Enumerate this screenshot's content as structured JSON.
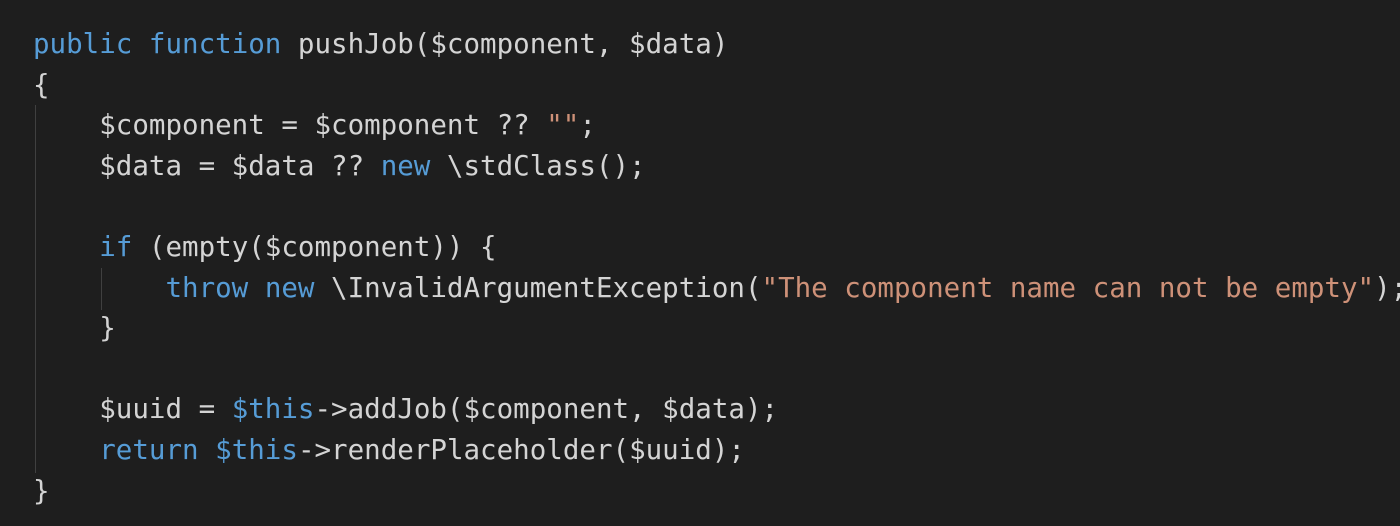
{
  "code": {
    "lines": [
      [
        {
          "t": "public",
          "c": "kw"
        },
        {
          "t": " ",
          "c": "plain"
        },
        {
          "t": "function",
          "c": "kw"
        },
        {
          "t": " pushJob($component, $data)",
          "c": "plain"
        }
      ],
      [
        {
          "t": "{",
          "c": "plain"
        }
      ],
      [
        {
          "t": "    $component = $component ?? ",
          "c": "plain"
        },
        {
          "t": "\"\"",
          "c": "str"
        },
        {
          "t": ";",
          "c": "plain"
        }
      ],
      [
        {
          "t": "    $data = $data ?? ",
          "c": "plain"
        },
        {
          "t": "new",
          "c": "kw"
        },
        {
          "t": " \\stdClass();",
          "c": "plain"
        }
      ],
      [],
      [
        {
          "t": "    ",
          "c": "plain"
        },
        {
          "t": "if",
          "c": "kw"
        },
        {
          "t": " (empty($component)) {",
          "c": "plain"
        }
      ],
      [
        {
          "t": "        ",
          "c": "plain"
        },
        {
          "t": "throw",
          "c": "kw"
        },
        {
          "t": " ",
          "c": "plain"
        },
        {
          "t": "new",
          "c": "kw"
        },
        {
          "t": " \\InvalidArgumentException(",
          "c": "plain"
        },
        {
          "t": "\"The component name can not be empty\"",
          "c": "str"
        },
        {
          "t": ");",
          "c": "plain"
        }
      ],
      [
        {
          "t": "    }",
          "c": "plain"
        }
      ],
      [],
      [
        {
          "t": "    $uuid = ",
          "c": "plain"
        },
        {
          "t": "$this",
          "c": "kw"
        },
        {
          "t": "->addJob($component, $data);",
          "c": "plain"
        }
      ],
      [
        {
          "t": "    ",
          "c": "plain"
        },
        {
          "t": "return",
          "c": "kw"
        },
        {
          "t": " ",
          "c": "plain"
        },
        {
          "t": "$this",
          "c": "kw"
        },
        {
          "t": "->renderPlaceholder($uuid);",
          "c": "plain"
        }
      ],
      [
        {
          "t": "}",
          "c": "plain"
        }
      ]
    ]
  },
  "colors": {
    "background": "#1e1e1e",
    "text": "#d4d4d4",
    "keyword": "#569cd6",
    "string": "#ce9178",
    "indent_guide": "#404040"
  }
}
